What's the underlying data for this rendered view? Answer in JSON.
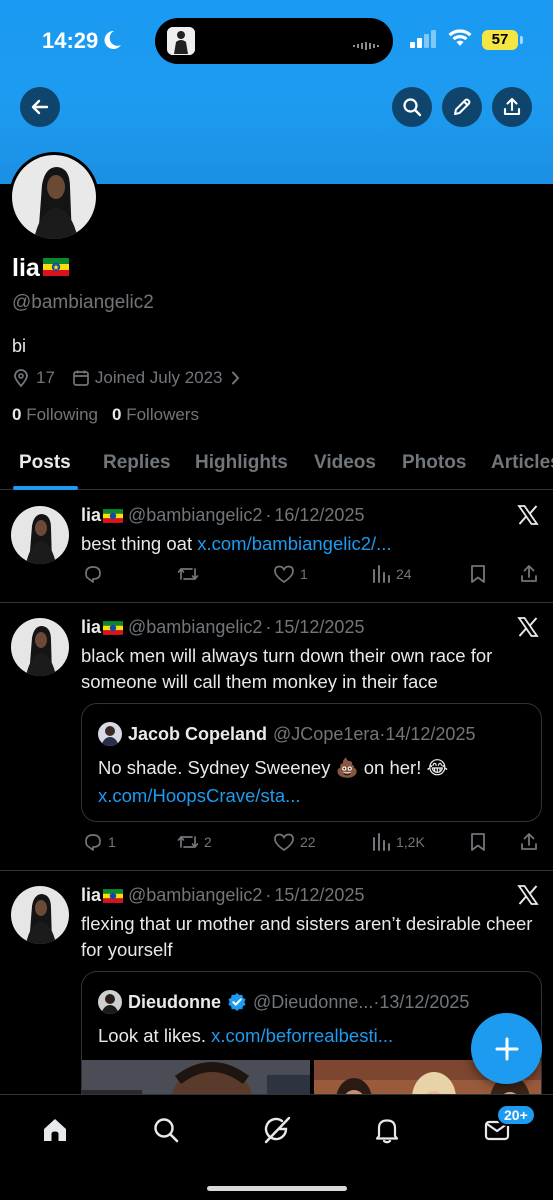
{
  "status_bar": {
    "time": "14:29",
    "battery": "57"
  },
  "header": {
    "back_icon": "arrow-left-icon",
    "search_icon": "search-icon",
    "edit_icon": "pencil-icon",
    "share_icon": "share-icon",
    "banner_color": "#1d9bf0"
  },
  "profile": {
    "name": "lia",
    "flag_icon": "ethiopia-flag-icon",
    "handle": "@bambiangelic2",
    "bio": "bi",
    "location": "17",
    "joined": "Joined July 2023",
    "following_count": "0",
    "following_label": "Following",
    "followers_count": "0",
    "followers_label": "Followers"
  },
  "tabs": [
    "Posts",
    "Replies",
    "Highlights",
    "Videos",
    "Photos",
    "Articles"
  ],
  "posts": [
    {
      "name": "lia",
      "handle": "@bambiangelic2",
      "date": "16/12/2025",
      "text": "best thing oat ",
      "link": "x.com/bambiangelic2/...",
      "replies": "",
      "reposts": "",
      "likes": "1",
      "views": "24"
    },
    {
      "name": "lia",
      "handle": "@bambiangelic2",
      "date": "15/12/2025",
      "text": "black men will always turn down their own race for someone will call them monkey in their face",
      "replies": "1",
      "reposts": "2",
      "likes": "22",
      "views": "1,2K",
      "quote": {
        "name": "Jacob Copeland",
        "handle": "@JCope1era",
        "date": "14/12/2025",
        "text": "No shade. Sydney Sweeney 💩 on her! 😂",
        "link": "x.com/HoopsCrave/sta..."
      }
    },
    {
      "name": "lia",
      "handle": "@bambiangelic2",
      "date": "15/12/2025",
      "text": "flexing that ur mother and sisters aren’t desirable cheer for yourself",
      "quote": {
        "name": "Dieudonne",
        "handle": "@Dieudonne...",
        "date": "13/12/2025",
        "text": "Look at likes. ",
        "link": "x.com/beforrealbesti...",
        "verified": true
      }
    }
  ],
  "bottom_nav": {
    "items": [
      "home-icon",
      "search-icon",
      "grok-icon",
      "bell-icon",
      "mail-icon"
    ],
    "messages_badge": "20+"
  },
  "fab_icon": "plus-icon",
  "accent_color": "#1d9bf0"
}
